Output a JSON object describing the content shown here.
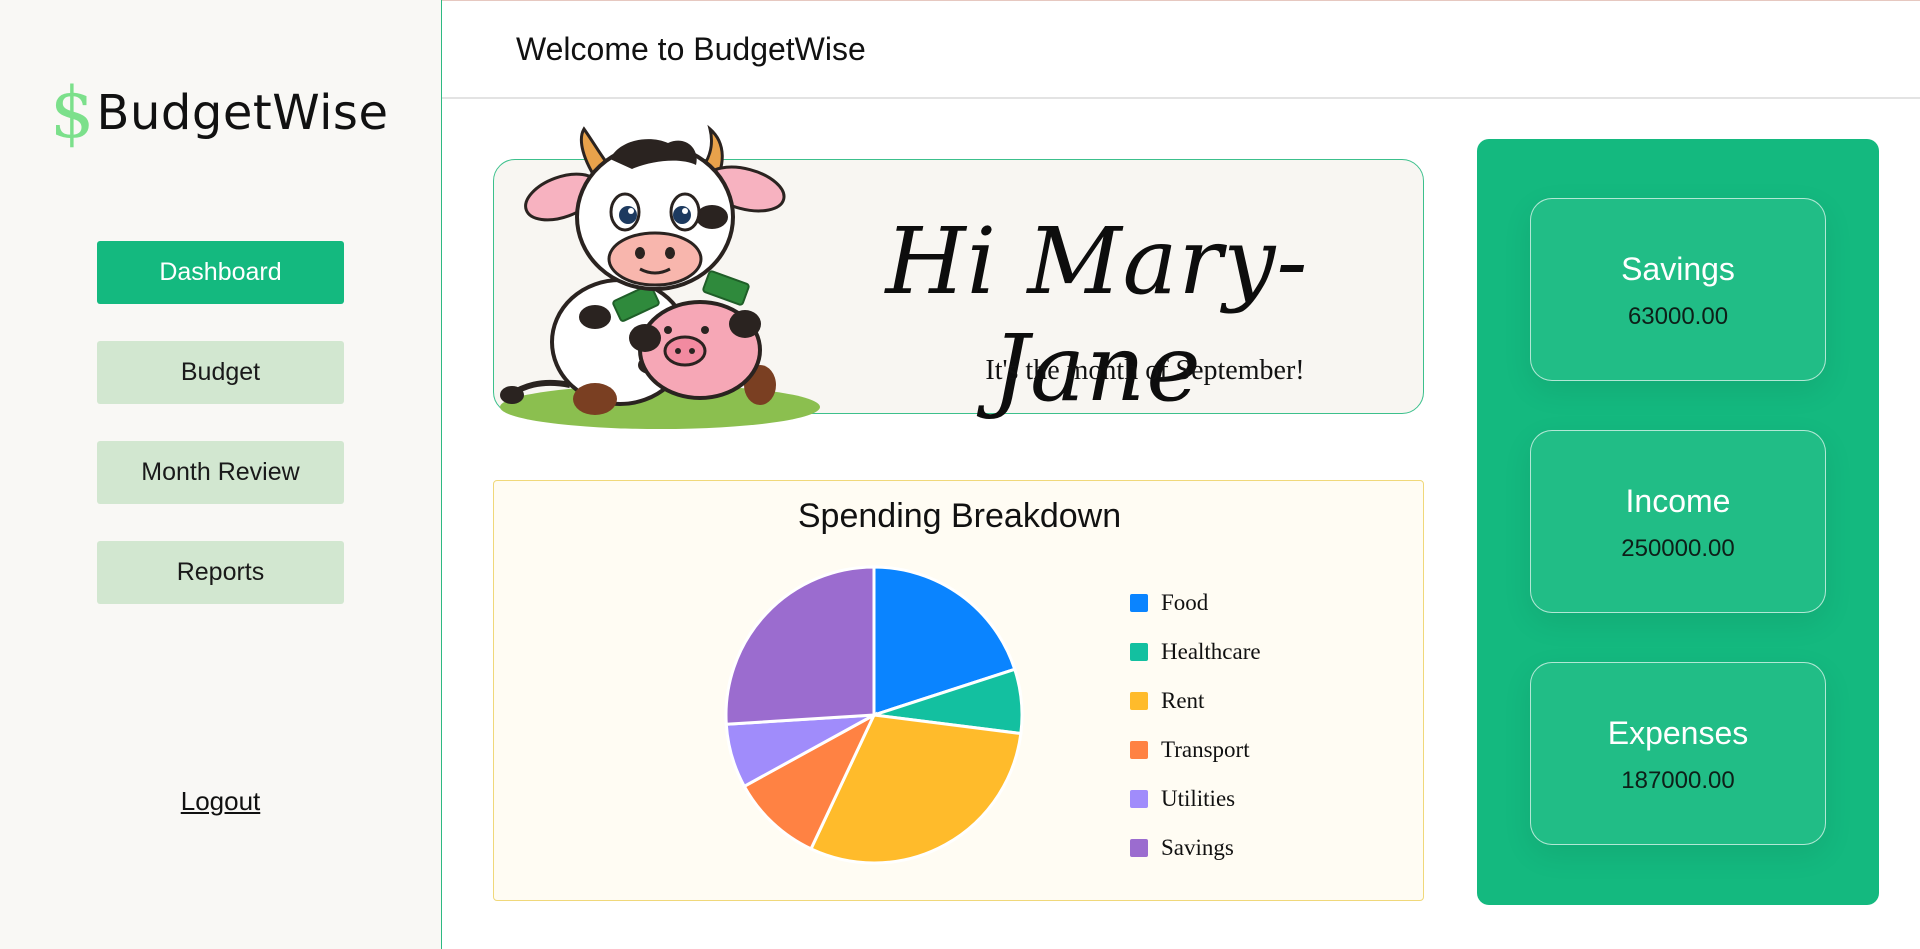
{
  "app": {
    "logo_icon": "$",
    "logo_text": "BudgetWise",
    "header_title": "Welcome to BudgetWise"
  },
  "sidebar": {
    "items": [
      {
        "label": "Dashboard",
        "active": true
      },
      {
        "label": "Budget",
        "active": false
      },
      {
        "label": "Month Review",
        "active": false
      },
      {
        "label": "Reports",
        "active": false
      }
    ],
    "logout_label": "Logout"
  },
  "greeting": {
    "name": "Hi Mary-Jane",
    "subtitle": "It's the month of September!",
    "mascot": "cow-with-piggy-bank-illustration"
  },
  "stats": {
    "savings": {
      "label": "Savings",
      "value": "63000.00"
    },
    "income": {
      "label": "Income",
      "value": "250000.00"
    },
    "expenses": {
      "label": "Expenses",
      "value": "187000.00"
    }
  },
  "colors": {
    "accent": "#14b97f",
    "nav_inactive": "#d2e7d0",
    "chart_card_border": "#f0d87a"
  },
  "chart_data": {
    "type": "pie",
    "title": "Spending Breakdown",
    "categories": [
      "Food",
      "Healthcare",
      "Rent",
      "Transport",
      "Utilities",
      "Savings"
    ],
    "values": [
      20,
      7,
      30,
      10,
      7,
      26
    ],
    "colors": [
      "#0a84ff",
      "#13c0a0",
      "#ffbb2b",
      "#ff8243",
      "#a08cfb",
      "#9b6ccf"
    ],
    "legend": "right"
  }
}
